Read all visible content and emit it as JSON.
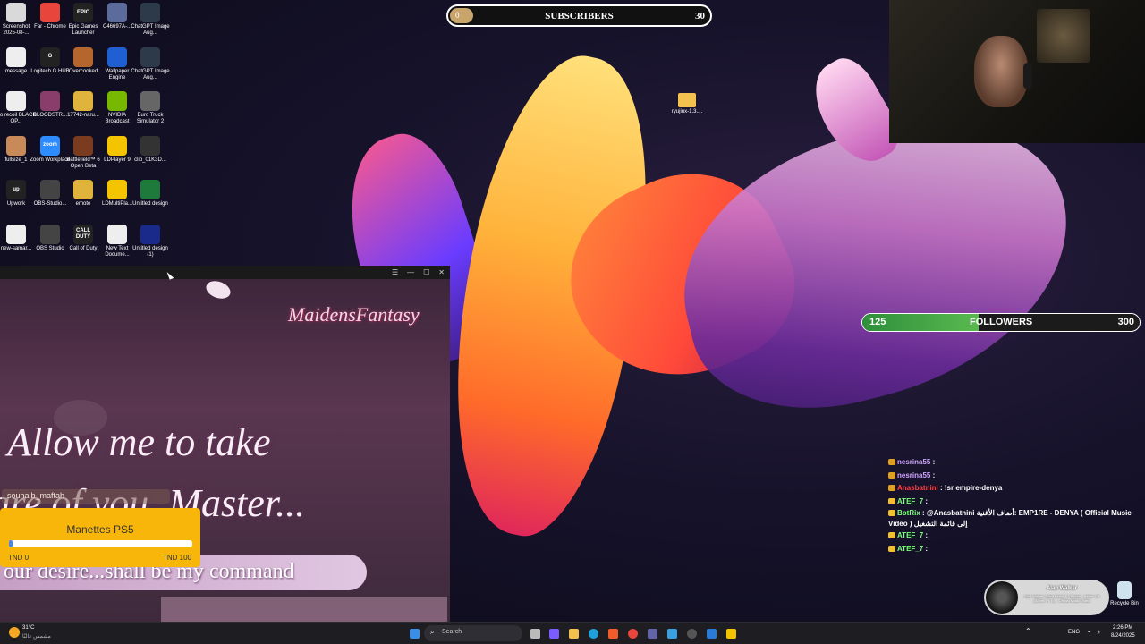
{
  "desktop_icons": [
    {
      "label": "Screenshot 2025-08-...",
      "color": "#d9d9d9",
      "glyph": ""
    },
    {
      "label": "Far - Chrome",
      "color": "#e8453c",
      "glyph": ""
    },
    {
      "label": "Epic Games Launcher",
      "color": "#222222",
      "glyph": "EPIC"
    },
    {
      "label": "C46697A-...",
      "color": "#5b6b9c",
      "glyph": ""
    },
    {
      "label": "ChatGPT Image Aug...",
      "color": "#2d3a4a",
      "glyph": ""
    },
    {
      "label": "message",
      "color": "#eeeeee",
      "glyph": ""
    },
    {
      "label": "Logitech G HUB",
      "color": "#222222",
      "glyph": "G"
    },
    {
      "label": "Overcooked",
      "color": "#b5662c",
      "glyph": ""
    },
    {
      "label": "Wallpaper Engine",
      "color": "#1f5fd1",
      "glyph": ""
    },
    {
      "label": "ChatGPT Image Aug...",
      "color": "#2d3a4a",
      "glyph": ""
    },
    {
      "label": "No recoil BLACK OP...",
      "color": "#eeeeee",
      "glyph": ""
    },
    {
      "label": "BLOODSTR...",
      "color": "#8a3d6a",
      "glyph": ""
    },
    {
      "label": "17742-naru...",
      "color": "#e0b33c",
      "glyph": ""
    },
    {
      "label": "NVIDIA Broadcast",
      "color": "#76b900",
      "glyph": ""
    },
    {
      "label": "Euro Truck Simulator 2",
      "color": "#666666",
      "glyph": ""
    },
    {
      "label": "fullsize_1",
      "color": "#c98a5a",
      "glyph": ""
    },
    {
      "label": "Zoom Workplace",
      "color": "#2d8cff",
      "glyph": "zoom"
    },
    {
      "label": "Battlefield™ 6 Open Beta",
      "color": "#7a3b1e",
      "glyph": ""
    },
    {
      "label": "LDPlayer 9",
      "color": "#f5c400",
      "glyph": ""
    },
    {
      "label": "clip_01K3D...",
      "color": "#333333",
      "glyph": ""
    },
    {
      "label": "Upwork",
      "color": "#222222",
      "glyph": "up"
    },
    {
      "label": "OBS-Studio...",
      "color": "#444444",
      "glyph": ""
    },
    {
      "label": "emote",
      "color": "#e0b33c",
      "glyph": ""
    },
    {
      "label": "LDMultiPla...",
      "color": "#f5c400",
      "glyph": ""
    },
    {
      "label": "Untitled design",
      "color": "#1e7a3a",
      "glyph": ""
    },
    {
      "label": "new-samar...",
      "color": "#eeeeee",
      "glyph": ""
    },
    {
      "label": "OBS Studio",
      "color": "#444444",
      "glyph": ""
    },
    {
      "label": "Call of Duty",
      "color": "#222222",
      "glyph": "CALL DUTY"
    },
    {
      "label": "New Text Docume...",
      "color": "#eeeeee",
      "glyph": ""
    },
    {
      "label": "Untitled design (1)",
      "color": "#1a2a8a",
      "glyph": ""
    }
  ],
  "desktop_folder": {
    "label": "ryujinx-1.3...."
  },
  "subscribers": {
    "count": "0",
    "label": "SUBSCRIBERS",
    "goal": "30",
    "progress": 0.0
  },
  "followers": {
    "count": "125",
    "label": "FOLLOWERS",
    "goal": "300",
    "progress": 0.42
  },
  "game": {
    "logo": "MaidensFantasy",
    "line1": "Allow me to take",
    "line2": "care of you, Master...",
    "line3": "our desire...shall be my command",
    "overlay_name": "souhaib_maftah"
  },
  "donation": {
    "title": "Manettes PS5",
    "min": "TND 0",
    "max": "TND 100",
    "progress": 0.02
  },
  "chat": [
    {
      "user": "nesrina55",
      "sep": " : ",
      "msg": "",
      "color": "#cfa5ff"
    },
    {
      "user": "nesrina55",
      "sep": " : ",
      "msg": "",
      "color": "#cfa5ff"
    },
    {
      "user": "Anasbatnini",
      "sep": " : ",
      "msg": "!sr empire-denya",
      "color": "#ff4040"
    },
    {
      "user": "ATEF_7",
      "sep": " : ",
      "msg": "",
      "color": "#7cff7c"
    },
    {
      "user": "BotRix",
      "sep": " : ",
      "msg": "@Anasbatnini أضاف الأغنية: EMP1RE - DENYA ( Official Music Video ) إلى قائمة التشغيل",
      "color": "#7cff7c"
    },
    {
      "user": "ATEF_7",
      "sep": " : ",
      "msg": "",
      "color": "#7cff7c"
    },
    {
      "user": "ATEF_7",
      "sep": " : ",
      "msg": "",
      "color": "#7cff7c"
    }
  ],
  "now_playing": {
    "artist": "Alan Walker",
    "track": "Alan Walker, Dash Berlin & Vikkstar - Better Off (Alone, Pt. III) - Official Music Video"
  },
  "recycle_bin": {
    "label": "Recycle Bin"
  },
  "taskbar": {
    "weather_temp": "31°C",
    "weather_desc": "مشمس غالبًا",
    "search_placeholder": "Search",
    "language": "ENG",
    "time": "2:26 PM",
    "date": "8/24/2025"
  }
}
